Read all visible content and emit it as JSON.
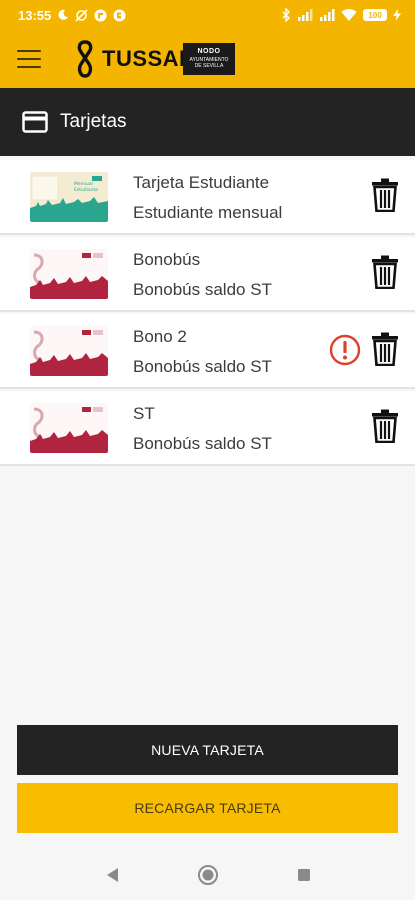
{
  "status_bar": {
    "time": "13:55",
    "battery": "100"
  },
  "app_bar": {
    "logo_text": "TUSSAM",
    "ayto_title": "NODO",
    "ayto_line1": "AYUNTAMIENTO",
    "ayto_line2": "DE SEVILLA"
  },
  "section": {
    "title": "Tarjetas"
  },
  "cards": [
    {
      "name": "Tarjeta Estudiante",
      "type": "Estudiante mensual",
      "style": "student",
      "alert": false
    },
    {
      "name": "Bonobús",
      "type": "Bonobús saldo ST",
      "style": "bono",
      "alert": false
    },
    {
      "name": "Bono 2",
      "type": "Bonobús saldo ST",
      "style": "bono",
      "alert": true
    },
    {
      "name": "ST",
      "type": "Bonobús saldo ST",
      "style": "bono",
      "alert": false
    }
  ],
  "buttons": {
    "new_card": "NUEVA TARJETA",
    "recharge": "RECARGAR TARJETA"
  },
  "colors": {
    "brand_yellow": "#f4b500",
    "dark": "#232323",
    "alert_red": "#e0412b",
    "bono_red": "#b0243f",
    "student_green": "#2aa68e"
  },
  "icons": {
    "menu": "hamburger-icon",
    "card": "credit-card-icon",
    "delete": "trash-icon",
    "warning": "alert-circle-icon"
  }
}
